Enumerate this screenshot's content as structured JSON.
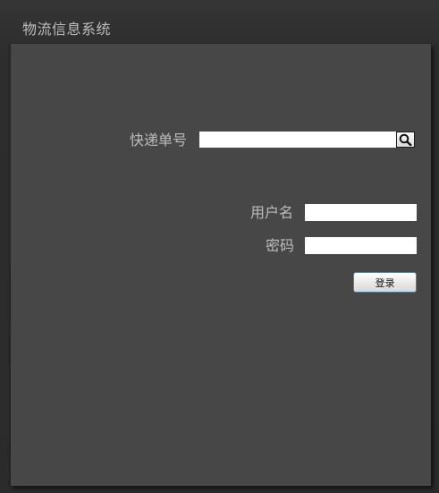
{
  "window": {
    "title": "物流信息系统"
  },
  "tracking": {
    "label": "快递单号",
    "value": "",
    "search_icon": "magnifier-icon"
  },
  "login": {
    "username_label": "用户名",
    "username_value": "",
    "password_label": "密码",
    "password_value": "",
    "submit_label": "登录"
  },
  "colors": {
    "background": "#2f2f2f",
    "panel": "#474747",
    "label_text": "#bcbcbc",
    "title_text": "#bdbdbd"
  }
}
